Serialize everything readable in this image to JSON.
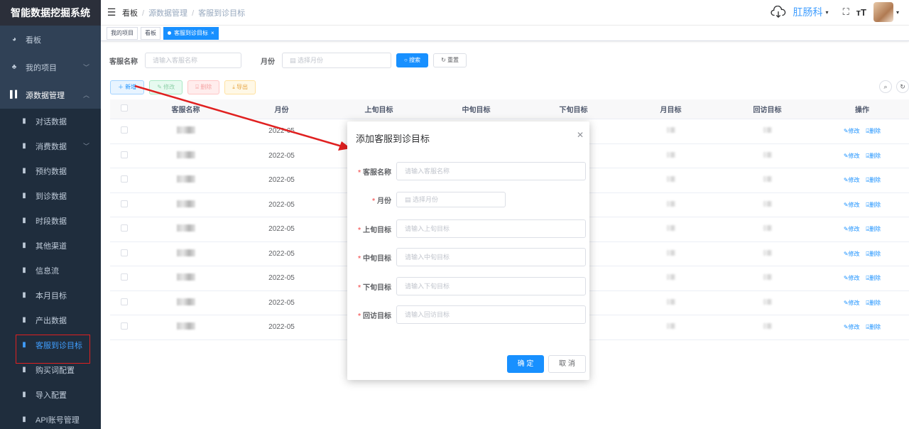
{
  "app": {
    "title": "智能数据挖掘系统"
  },
  "sidebar": {
    "items": [
      {
        "label": "看板",
        "icon": "dashboard-icon"
      },
      {
        "label": "我的项目",
        "icon": "tree-icon"
      },
      {
        "label": "源数据管理",
        "icon": "chart-icon"
      }
    ],
    "sub_items": [
      {
        "label": "对话数据"
      },
      {
        "label": "消费数据"
      },
      {
        "label": "预约数据"
      },
      {
        "label": "到诊数据"
      },
      {
        "label": "时段数据"
      },
      {
        "label": "其他渠道"
      },
      {
        "label": "信息流"
      },
      {
        "label": "本月目标"
      },
      {
        "label": "产出数据"
      },
      {
        "label": "客服到诊目标"
      },
      {
        "label": "购买词配置"
      },
      {
        "label": "导入配置"
      },
      {
        "label": "API账号管理"
      }
    ]
  },
  "navbar": {
    "breadcrumb": [
      "看板",
      "源数据管理",
      "客服到诊目标"
    ],
    "username": "肛肠科"
  },
  "tags": [
    {
      "label": "我的项目"
    },
    {
      "label": "看板"
    },
    {
      "label": "客服到诊目标"
    }
  ],
  "search": {
    "name_label": "客服名称",
    "name_placeholder": "请输入客服名称",
    "month_label": "月份",
    "month_placeholder": "选择月份",
    "search_button": "搜索",
    "reset_button": "重置"
  },
  "toolbar": {
    "add": "新增",
    "edit": "修改",
    "delete": "删除",
    "export": "导出"
  },
  "table": {
    "headers": [
      "客服名称",
      "月份",
      "上旬目标",
      "中旬目标",
      "下旬目标",
      "月目标",
      "回访目标",
      "操作"
    ],
    "months": [
      "2022-05",
      "2022-05",
      "2022-05",
      "2022-05",
      "2022-05",
      "2022-05",
      "2022-05",
      "2022-05",
      "2022-05"
    ],
    "edit_label": "修改",
    "delete_label": "删除"
  },
  "dialog": {
    "title": "添加客服到诊目标",
    "fields": [
      {
        "label": "客服名称",
        "placeholder": "请输入客服名称"
      },
      {
        "label": "月份",
        "placeholder": "选择月份"
      },
      {
        "label": "上旬目标",
        "placeholder": "请输入上旬目标"
      },
      {
        "label": "中旬目标",
        "placeholder": "请输入中旬目标"
      },
      {
        "label": "下旬目标",
        "placeholder": "请输入下旬目标"
      },
      {
        "label": "回访目标",
        "placeholder": "请输入回访目标"
      }
    ],
    "confirm": "确 定",
    "cancel": "取 消"
  },
  "colors": {
    "accent": "#1890ff",
    "sidebar": "#304156",
    "annotation": "#e02020"
  }
}
